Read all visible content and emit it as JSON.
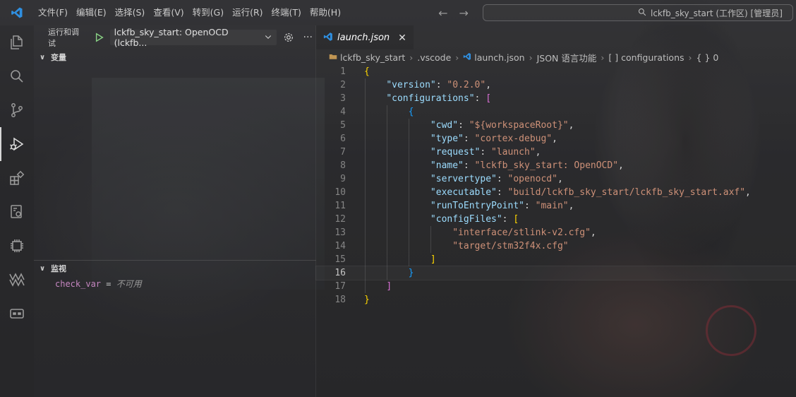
{
  "menu": [
    "文件(F)",
    "编辑(E)",
    "选择(S)",
    "查看(V)",
    "转到(G)",
    "运行(R)",
    "终端(T)",
    "帮助(H)"
  ],
  "search": {
    "text": "lckfb_sky_start (工作区) [管理员]"
  },
  "sidebar": {
    "title": "运行和调试",
    "config": "lckfb_sky_start: OpenOCD (lckfb...",
    "more": "···",
    "variables_header": "变量",
    "watch_header": "监视",
    "watch": {
      "name": "check_var",
      "eq": " = ",
      "value": "不可用"
    }
  },
  "editor": {
    "tab_label": "launch.json",
    "close_glyph": "✕",
    "breadcrumb": [
      "lckfb_sky_start",
      ".vscode",
      "launch.json",
      "JSON 语言功能",
      "[ ] configurations",
      "{ } 0"
    ],
    "lines": [
      {
        "n": "1"
      },
      {
        "n": "2"
      },
      {
        "n": "3"
      },
      {
        "n": "4"
      },
      {
        "n": "5"
      },
      {
        "n": "6"
      },
      {
        "n": "7"
      },
      {
        "n": "8"
      },
      {
        "n": "9"
      },
      {
        "n": "10"
      },
      {
        "n": "11"
      },
      {
        "n": "12"
      },
      {
        "n": "13"
      },
      {
        "n": "14"
      },
      {
        "n": "15"
      },
      {
        "n": "16"
      },
      {
        "n": "17"
      },
      {
        "n": "18"
      }
    ],
    "code": {
      "open": "{",
      "version_key": "\"version\"",
      "version_val": "\"0.2.0\"",
      "configs_key": "\"configurations\"",
      "cwd_key": "\"cwd\"",
      "cwd_val": "\"${workspaceRoot}\"",
      "type_key": "\"type\"",
      "type_val": "\"cortex-debug\"",
      "request_key": "\"request\"",
      "request_val": "\"launch\"",
      "name_key": "\"name\"",
      "name_val": "\"lckfb_sky_start: OpenOCD\"",
      "servertype_key": "\"servertype\"",
      "servertype_val": "\"openocd\"",
      "exec_key": "\"executable\"",
      "exec_val": "\"build/lckfb_sky_start/lckfb_sky_start.axf\"",
      "entry_key": "\"runToEntryPoint\"",
      "entry_val": "\"main\"",
      "cfgfiles_key": "\"configFiles\"",
      "cfg1": "\"interface/stlink-v2.cfg\"",
      "cfg2": "\"target/stm32f4x.cfg\""
    }
  },
  "icons": [
    "vscode-logo-icon",
    "explorer-icon",
    "search-icon",
    "source-control-icon",
    "run-debug-icon",
    "extensions-icon",
    "remote-icon",
    "chip-icon",
    "platformio-icon",
    "serial-monitor-icon"
  ],
  "colors": {
    "accent": "#0078d4",
    "key": "#9cdcfe",
    "string": "#ce9178",
    "bracket_gold": "#ffd700",
    "bracket_purple": "#da70d6",
    "bracket_blue": "#179fff"
  }
}
